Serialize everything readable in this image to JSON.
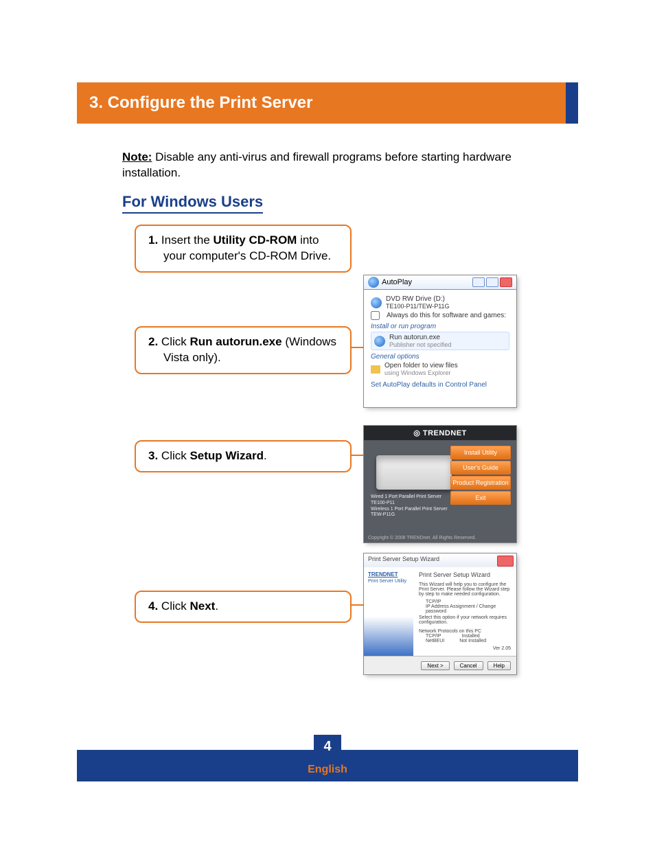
{
  "header": {
    "title": "3. Configure the Print Server"
  },
  "note": {
    "label": "Note:",
    "text": " Disable any anti-virus and firewall programs before starting hardware installation."
  },
  "subtitle": "For Windows Users",
  "steps": {
    "s1": {
      "n": "1.",
      "pre": " Insert the ",
      "bold": "Utility CD-ROM",
      "post": " into your computer's CD-ROM Drive."
    },
    "s2": {
      "n": "2.",
      "pre": " Click ",
      "bold": "Run autorun.exe",
      "post": " (Windows Vista only)."
    },
    "s3": {
      "n": "3.",
      "pre": " Click ",
      "bold": "Setup Wizard",
      "post": "."
    },
    "s4": {
      "n": "4.",
      "pre": " Click ",
      "bold": "Next",
      "post": "."
    }
  },
  "autoplay": {
    "window_title": "AutoPlay",
    "drive": "DVD RW Drive (D:)",
    "label": "TE100-P11/TEW-P11G",
    "always": "Always do this for software and games:",
    "section1": "Install or run program",
    "run_item": "Run autorun.exe",
    "run_sub": "Publisher not specified",
    "section2": "General options",
    "open_folder": "Open folder to view files",
    "open_sub": "using Windows Explorer",
    "link": "Set AutoPlay defaults in Control Panel"
  },
  "trendnet": {
    "brand": "TRENDNET",
    "btn1": "Install Utility",
    "btn2": "User's Guide",
    "btn3": "Product Registration",
    "btn4": "Exit",
    "desc1": "Wired 1 Port Parallel Print Server",
    "desc2": "TE100-P11",
    "desc3": "Wireless 1 Port Parallel Print Server",
    "desc4": "TEW-P11G",
    "copyright": "Copyright © 2008 TRENDnet. All Rights Reserved."
  },
  "wizard": {
    "window_title": "Print Server Setup Wizard",
    "side_brand": "TRENDNET",
    "side_sub": "Print Server Utility",
    "title": "Print Server Setup Wizard",
    "line1": "This Wizard will help you to configure the Print Server. Please follow the Wizard step by step to make needed configuration.",
    "line2": "TCP/IP",
    "line3": "IP Address Assignment / Change password",
    "line4": "Select this option if your network requires configuration.",
    "group": "Network Protocols on this PC",
    "g1a": "TCP/IP",
    "g1b": "Installed",
    "g2a": "NetBEUI",
    "g2b": "Not Installed",
    "version": "Ver 2.05",
    "btn_next": "Next >",
    "btn_cancel": "Cancel",
    "btn_help": "Help"
  },
  "footer": {
    "page": "4",
    "lang": "English"
  }
}
